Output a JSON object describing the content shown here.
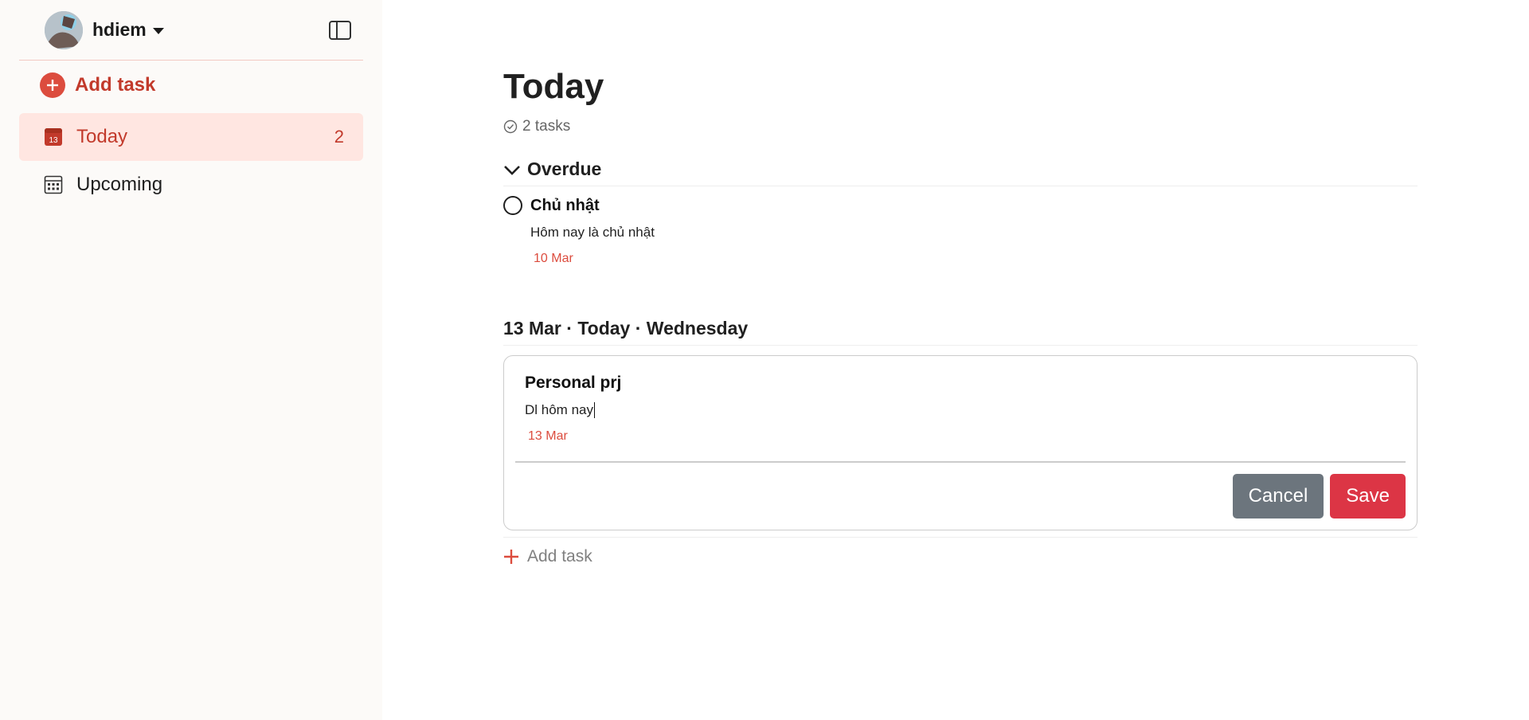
{
  "sidebar": {
    "username": "hdiem",
    "add_task_label": "Add task",
    "items": [
      {
        "label": "Today",
        "count": "2",
        "icon": "calendar-today-icon",
        "active": true
      },
      {
        "label": "Upcoming",
        "count": "",
        "icon": "calendar-grid-icon",
        "active": false
      }
    ],
    "today_icon_number": "13"
  },
  "main": {
    "title": "Today",
    "task_count": "2 tasks",
    "sections": {
      "overdue": {
        "label": "Overdue",
        "tasks": [
          {
            "title": "Chủ nhật",
            "description": "Hôm nay là chủ nhật",
            "date": "10 Mar"
          }
        ]
      },
      "today": {
        "label": "13 Mar · Today · Wednesday",
        "editor": {
          "title": "Personal prj",
          "description": "Dl hôm nay",
          "date": "13 Mar",
          "cancel_label": "Cancel",
          "save_label": "Save"
        }
      }
    },
    "add_task_label": "Add task"
  },
  "colors": {
    "accent": "#dc4c3e",
    "sidebar_bg": "#fcfaf8",
    "active_bg": "#ffe6e1",
    "cancel_btn": "#6c757d",
    "save_btn": "#dc3545"
  }
}
